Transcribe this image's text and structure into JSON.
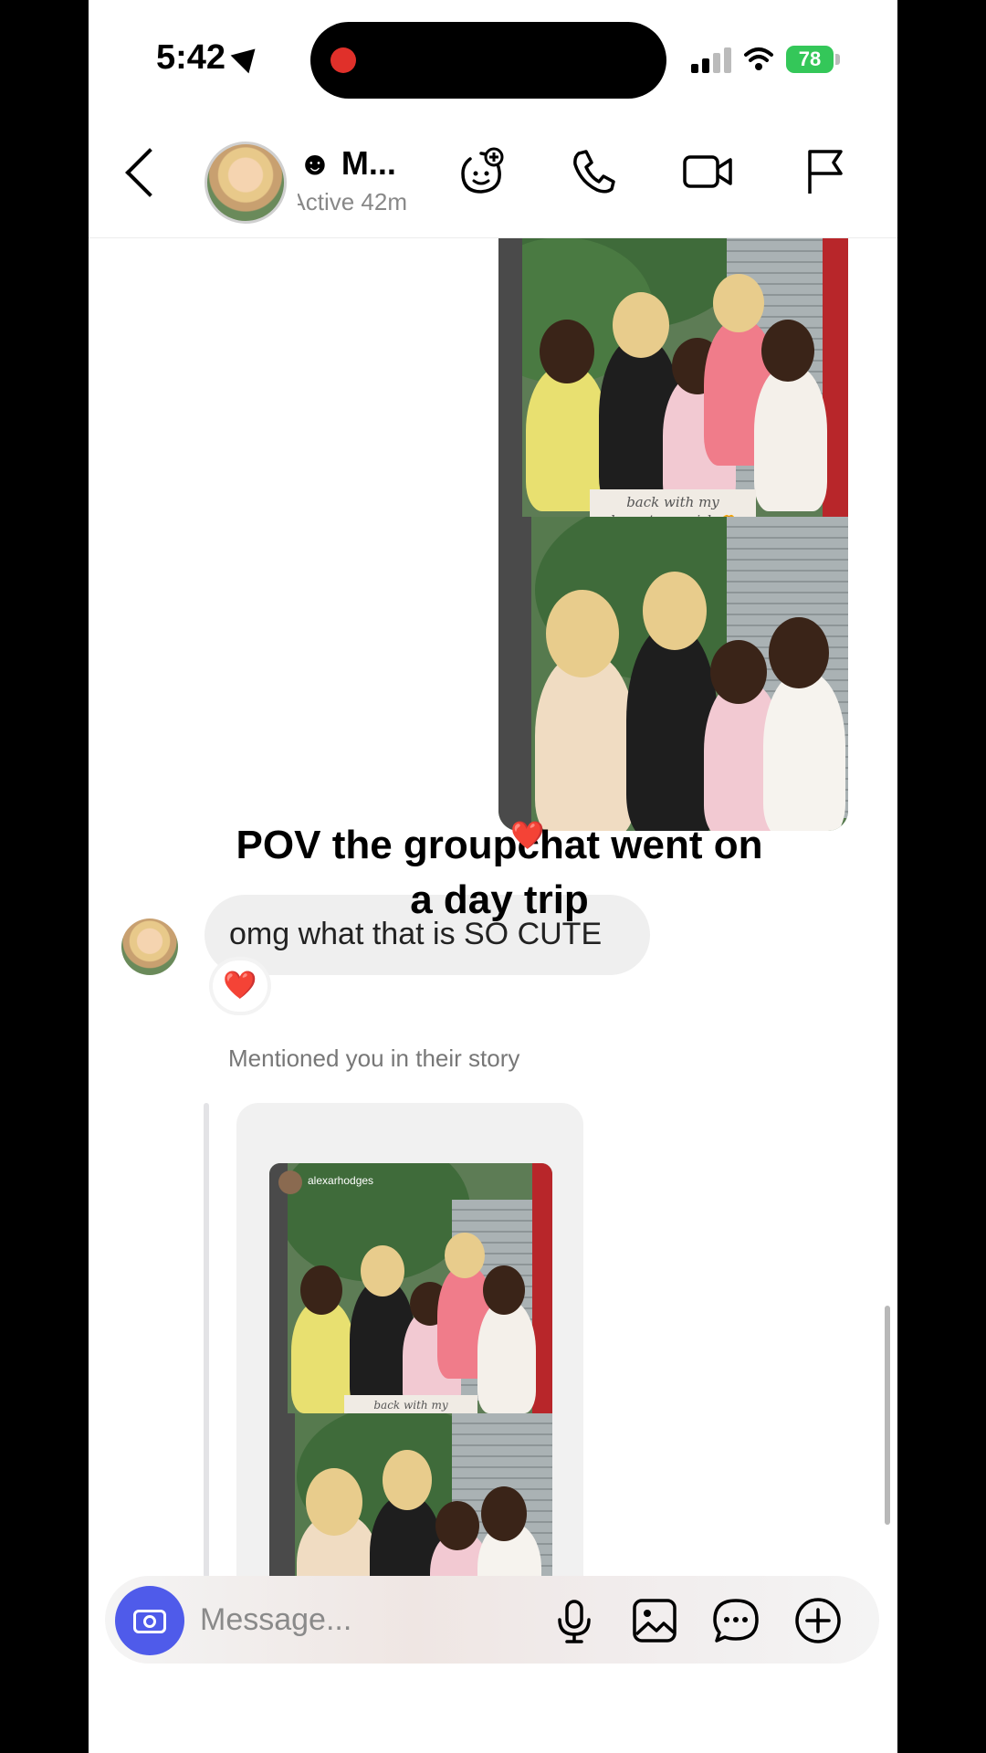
{
  "status_bar": {
    "time": "5:42",
    "battery": "78"
  },
  "header": {
    "contact_name": "☻ M...",
    "activity": "Active 42m",
    "icons": [
      "back-chevron-icon",
      "effects-icon",
      "phone-icon",
      "video-camera-icon",
      "flag-icon"
    ]
  },
  "messages": {
    "shared_post_caption": "back with my hometown girls🫶",
    "shared_post_reaction": "❤️",
    "overlay_caption": "POV the groupchat went on a day trip",
    "received_text": "omg what that is SO CUTE",
    "received_reaction": "❤️",
    "mention_text": "Mentioned you in their story",
    "story_username": "alexarhodges",
    "story_caption": "back with my hometown girls🫶"
  },
  "composer": {
    "placeholder": "Message...",
    "icons": [
      "camera-icon",
      "microphone-icon",
      "gallery-icon",
      "sticker-icon",
      "plus-icon"
    ]
  },
  "colors": {
    "accent": "#4f5bea",
    "battery": "#34c759",
    "heart": "#e0263a"
  }
}
